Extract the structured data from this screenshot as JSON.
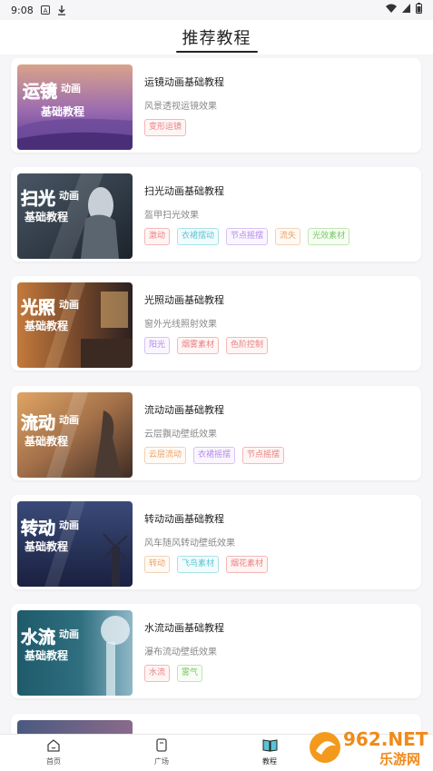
{
  "status": {
    "time": "9:08"
  },
  "header": {
    "title": "推荐教程"
  },
  "tutorials": [
    {
      "title": "运镜动画基础教程",
      "subtitle": "风景透视运镜效果",
      "thumb_big": "运镜",
      "thumb_small": "动画",
      "thumb_line2": "基础教程",
      "tags": [
        {
          "label": "变形运镜",
          "color": "pink"
        }
      ]
    },
    {
      "title": "扫光动画基础教程",
      "subtitle": "盔甲扫光效果",
      "thumb_big": "扫光",
      "thumb_small": "动画",
      "thumb_line2": "基础教程",
      "tags": [
        {
          "label": "激动",
          "color": "pink"
        },
        {
          "label": "衣裙摆动",
          "color": "cyan"
        },
        {
          "label": "节点摇摆",
          "color": "purple"
        },
        {
          "label": "流失",
          "color": "orange"
        },
        {
          "label": "光效素材",
          "color": "green"
        }
      ]
    },
    {
      "title": "光照动画基础教程",
      "subtitle": "窗外光线照射效果",
      "thumb_big": "光照",
      "thumb_small": "动画",
      "thumb_line2": "基础教程",
      "tags": [
        {
          "label": "阳光",
          "color": "purple"
        },
        {
          "label": "烟雾素材",
          "color": "pink"
        },
        {
          "label": "色阶控制",
          "color": "pink"
        }
      ]
    },
    {
      "title": "流动动画基础教程",
      "subtitle": "云层飘动壁纸效果",
      "thumb_big": "流动",
      "thumb_small": "动画",
      "thumb_line2": "基础教程",
      "tags": [
        {
          "label": "云层流动",
          "color": "orange"
        },
        {
          "label": "衣裙摇摆",
          "color": "purple"
        },
        {
          "label": "节点摇摆",
          "color": "pink"
        }
      ]
    },
    {
      "title": "转动动画基础教程",
      "subtitle": "风车随风转动壁纸效果",
      "thumb_big": "转动",
      "thumb_small": "动画",
      "thumb_line2": "基础教程",
      "tags": [
        {
          "label": "转动",
          "color": "orange"
        },
        {
          "label": "飞鸟素材",
          "color": "cyan"
        },
        {
          "label": "烟花素材",
          "color": "pink"
        }
      ]
    },
    {
      "title": "水流动画基础教程",
      "subtitle": "瀑布流动壁纸效果",
      "thumb_big": "水流",
      "thumb_small": "动画",
      "thumb_line2": "基础教程",
      "tags": [
        {
          "label": "水流",
          "color": "pink"
        },
        {
          "label": "雾气",
          "color": "green"
        }
      ]
    }
  ],
  "nav": {
    "home": "首页",
    "square": "广场",
    "tutorial": "教程"
  },
  "watermark": {
    "brand": "962.NET",
    "sub": "乐游网"
  }
}
